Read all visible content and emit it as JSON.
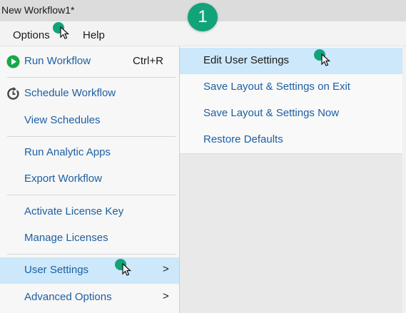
{
  "window": {
    "title": "New Workflow1*"
  },
  "step_badge": {
    "text": "1",
    "color": "#12a37b"
  },
  "menubar": {
    "options_label": "Options",
    "help_label": "Help"
  },
  "options_menu": {
    "items": [
      {
        "label": "Run Workflow",
        "shortcut": "Ctrl+R",
        "icon": "play-icon"
      },
      {
        "label": "Schedule Workflow",
        "icon": "schedule-icon"
      },
      {
        "label": "View Schedules"
      },
      {
        "label": "Run Analytic Apps"
      },
      {
        "label": "Export Workflow"
      },
      {
        "label": "Activate License Key"
      },
      {
        "label": "Manage Licenses"
      },
      {
        "label": "User Settings",
        "arrow": ">"
      },
      {
        "label": "Advanced Options",
        "arrow": ">"
      }
    ]
  },
  "user_settings_submenu": {
    "items": [
      {
        "label": "Edit User Settings"
      },
      {
        "label": "Save Layout & Settings on Exit"
      },
      {
        "label": "Save Layout & Settings Now"
      },
      {
        "label": "Restore Defaults"
      }
    ]
  },
  "colors": {
    "menu_text": "#1d5fa3",
    "highlight": "#cce8fa",
    "accent_green": "#12a37b"
  }
}
